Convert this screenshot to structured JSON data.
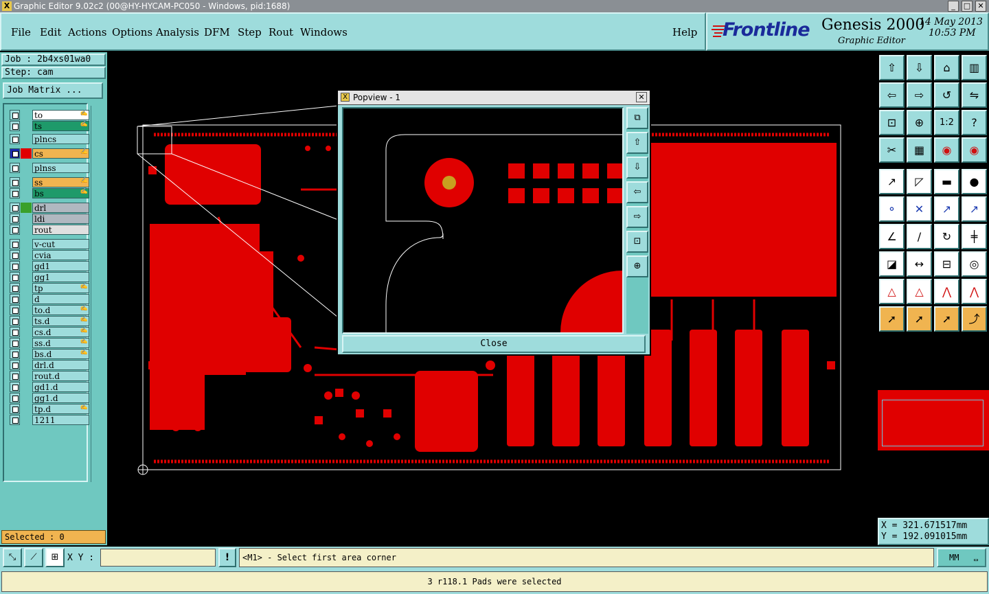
{
  "window": {
    "title": "Graphic Editor 9.02c2 (00@HY-HYCAM-PC050 - Windows, pid:1688)",
    "min": "_",
    "max": "□",
    "close": "✕"
  },
  "menu": {
    "file": "File",
    "edit": "Edit",
    "actions": "Actions",
    "options": "Options",
    "analysis": "Analysis",
    "dfm": "DFM",
    "step": "Step",
    "rout": "Rout",
    "windows": "Windows",
    "help": "Help"
  },
  "brand": {
    "logo": "Frontline",
    "product": "Genesis 2000",
    "subtitle": "Graphic Editor",
    "date": "14 May 2013",
    "time": "10:53 PM"
  },
  "job": {
    "job_label": "Job : 2b4xs01wa0",
    "step_label": "Step: cam",
    "matrix_button": "Job Matrix ..."
  },
  "layers": [
    {
      "name": "to",
      "color": "#ffffff",
      "hand": true
    },
    {
      "name": "ts",
      "color": "#1e9a6a",
      "hand": true
    },
    {
      "name": "plncs",
      "color": "#9edcdc",
      "hand": false
    },
    {
      "name": "cs",
      "color": "#f0b450",
      "hand": true,
      "active": true
    },
    {
      "name": "plnss",
      "color": "#9edcdc",
      "hand": false
    },
    {
      "name": "ss",
      "color": "#f0b450",
      "hand": true
    },
    {
      "name": "bs",
      "color": "#1e9a6a",
      "hand": true
    },
    {
      "name": "drl",
      "color": "#b0b8c0",
      "hand": false
    },
    {
      "name": "ldi",
      "color": "#b0b8c0",
      "hand": false
    },
    {
      "name": "rout",
      "color": "#e0e0e0",
      "hand": false
    },
    {
      "name": "v-cut",
      "color": "#9edcdc",
      "hand": false
    },
    {
      "name": "cvia",
      "color": "#9edcdc",
      "hand": false
    },
    {
      "name": "gd1",
      "color": "#9edcdc",
      "hand": false
    },
    {
      "name": "gg1",
      "color": "#9edcdc",
      "hand": false
    },
    {
      "name": "tp",
      "color": "#9edcdc",
      "hand": true
    },
    {
      "name": "d",
      "color": "#9edcdc",
      "hand": false
    },
    {
      "name": "to.d",
      "color": "#9edcdc",
      "hand": true
    },
    {
      "name": "ts.d",
      "color": "#9edcdc",
      "hand": true
    },
    {
      "name": "cs.d",
      "color": "#9edcdc",
      "hand": true
    },
    {
      "name": "ss.d",
      "color": "#9edcdc",
      "hand": true
    },
    {
      "name": "bs.d",
      "color": "#9edcdc",
      "hand": true
    },
    {
      "name": "drl.d",
      "color": "#9edcdc",
      "hand": false
    },
    {
      "name": "rout.d",
      "color": "#9edcdc",
      "hand": false
    },
    {
      "name": "gd1.d",
      "color": "#9edcdc",
      "hand": false
    },
    {
      "name": "gg1.d",
      "color": "#9edcdc",
      "hand": false
    },
    {
      "name": "tp.d",
      "color": "#9edcdc",
      "hand": true
    },
    {
      "name": "1211",
      "color": "#9edcdc",
      "hand": false
    }
  ],
  "selected_label": "Selected : 0",
  "popview": {
    "title": "Popview - 1",
    "close_button": "Close",
    "close_icon": "✕"
  },
  "coords": {
    "x": "X = 321.671517mm",
    "y": "Y = 192.091015mm"
  },
  "command": {
    "xy_label": "X Y :",
    "xy_value": "",
    "prompt": "<M1> - Select first area corner",
    "units": "MM"
  },
  "status": "3 r118.1 Pads were selected",
  "icons": {
    "right_tools": [
      "zoom-home-icon",
      "zoom-out-icon",
      "home-icon",
      "panel-icon",
      "pan-left-icon",
      "pan-right-icon",
      "rotate-icon",
      "flip-icon",
      "fit-icon",
      "center-icon",
      "scale-1-2-icon",
      "help-icon",
      "measure-icon",
      "grid-icon",
      "snap-icon",
      "snap-active-icon",
      "select-icon",
      "draw-line-icon",
      "ruler-icon",
      "pad-icon",
      "connect-icon",
      "move-icon",
      "node-icon",
      "node-red-icon",
      "angle-icon",
      "line-icon",
      "arc-icon",
      "split-icon",
      "feature-icon",
      "break-icon",
      "array-icon",
      "group-icon",
      "triangle-icon",
      "triangle-blue-icon",
      "profile-icon",
      "outline-icon",
      "pointer-icon",
      "pointer-box-icon",
      "pointer-net-icon",
      "route-icon"
    ]
  }
}
